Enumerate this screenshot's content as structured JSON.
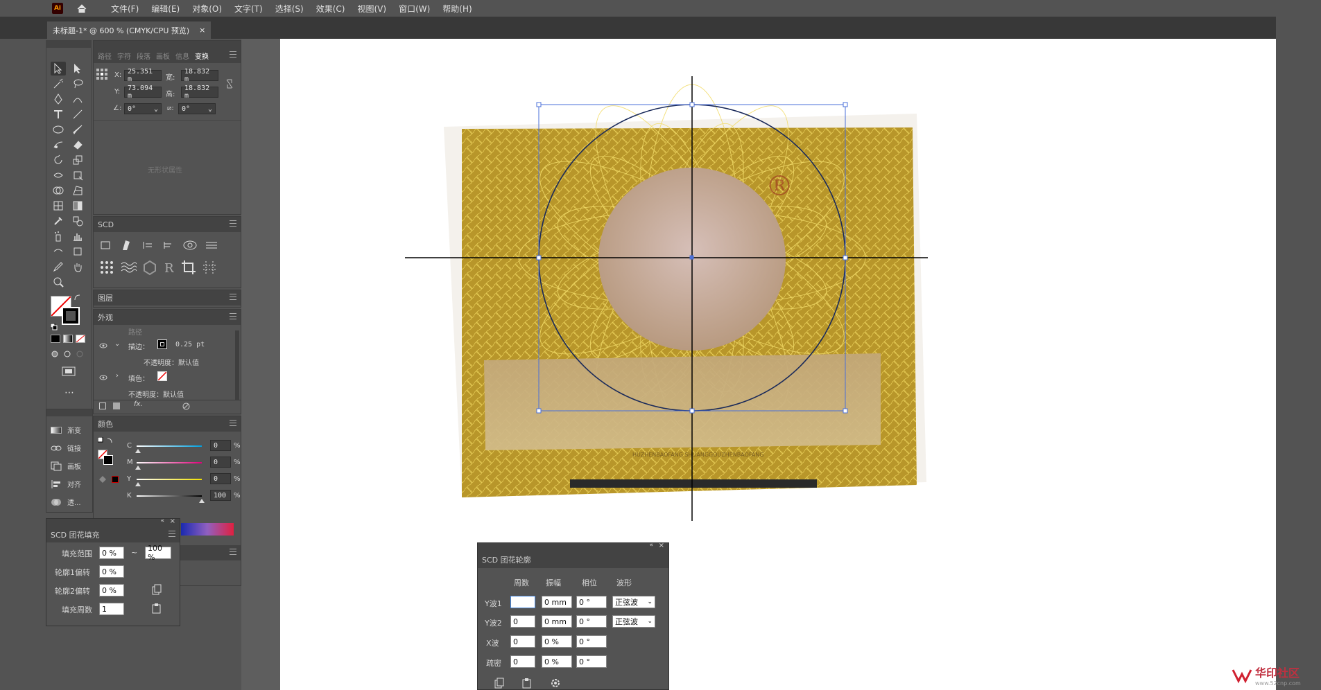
{
  "app": {
    "logo": "Ai",
    "home_icon": "home-icon"
  },
  "menu": [
    "文件(F)",
    "编辑(E)",
    "对象(O)",
    "文字(T)",
    "选择(S)",
    "效果(C)",
    "视图(V)",
    "窗口(W)",
    "帮助(H)"
  ],
  "document": {
    "tab_title": "未标题-1* @ 600 % (CMYK/CPU 预览)",
    "close": "×"
  },
  "transform_panel": {
    "tabs": [
      "路径",
      "字符",
      "段落",
      "画板",
      "信息",
      "变换"
    ],
    "active_tab": "变换",
    "x_label": "X:",
    "x_value": "25.351 m",
    "y_label": "Y:",
    "y_value": "73.094 m",
    "w_label": "宽:",
    "w_value": "18.832 m",
    "h_label": "高:",
    "h_value": "18.832 m",
    "angle_value": "0°",
    "shear_value": "0°",
    "empty_note": "无形状属性"
  },
  "scd_panel": {
    "title": "SCD"
  },
  "layers_panel": {
    "title": "图层"
  },
  "appearance_panel": {
    "title": "外观",
    "path_label": "路径",
    "stroke_label": "描边：",
    "stroke_value": "0.25 pt",
    "opacity1": "不透明度：默认值",
    "fill_label": "填色：",
    "opacity2": "不透明度：默认值",
    "fx_label": "fx."
  },
  "left_dock": {
    "items": [
      {
        "icon": "gradient-icon",
        "label": "渐变"
      },
      {
        "icon": "link-icon",
        "label": "链接"
      },
      {
        "icon": "artboard-icon",
        "label": "画板"
      },
      {
        "icon": "align-icon",
        "label": "对齐"
      },
      {
        "icon": "transparency-icon",
        "label": "透..."
      }
    ]
  },
  "color_panel": {
    "title": "颜色",
    "channels": [
      {
        "label": "C",
        "value": "0",
        "unit": "%"
      },
      {
        "label": "M",
        "value": "0",
        "unit": "%"
      },
      {
        "label": "Y",
        "value": "0",
        "unit": "%"
      },
      {
        "label": "K",
        "value": "100",
        "unit": "%"
      }
    ]
  },
  "scd_fill_panel": {
    "title": "SCD 团花填充",
    "range_label": "填充范围",
    "range_from": "0 %",
    "tilde": "~",
    "range_to": "100 %",
    "outline1_label": "轮廓1偏转",
    "outline1_value": "0 %",
    "outline2_label": "轮廓2偏转",
    "outline2_value": "0 %",
    "cycles_label": "填充周数",
    "cycles_value": "1"
  },
  "scd_outline_dialog": {
    "title": "SCD 团花轮廓",
    "col_headers": [
      "周数",
      "振幅",
      "相位",
      "波形"
    ],
    "rows": [
      {
        "label": "Y波1",
        "cycles": "",
        "amplitude": "0 mm",
        "phase": "0 °",
        "wave": "正弦波"
      },
      {
        "label": "Y波2",
        "cycles": "0",
        "amplitude": "0 mm",
        "phase": "0 °",
        "wave": "正弦波"
      },
      {
        "label": "X波",
        "cycles": "0",
        "amplitude": "0 %",
        "phase": "0 °"
      },
      {
        "label": "疏密",
        "cycles": "0",
        "amplitude": "0 %",
        "phase": "0 °"
      }
    ]
  },
  "artwork": {
    "trademark_symbol": "®",
    "band_text": "HUZHENBAOFANG SHUANGGOUZHENBAOFANG",
    "colors": {
      "gold": "#c9a227",
      "guilloche": "#e8c94a",
      "selection": "#4a6fd8",
      "center": "#c8b0a8"
    }
  },
  "watermark": {
    "text": "华印社区",
    "url": "www.52cnp.com"
  }
}
